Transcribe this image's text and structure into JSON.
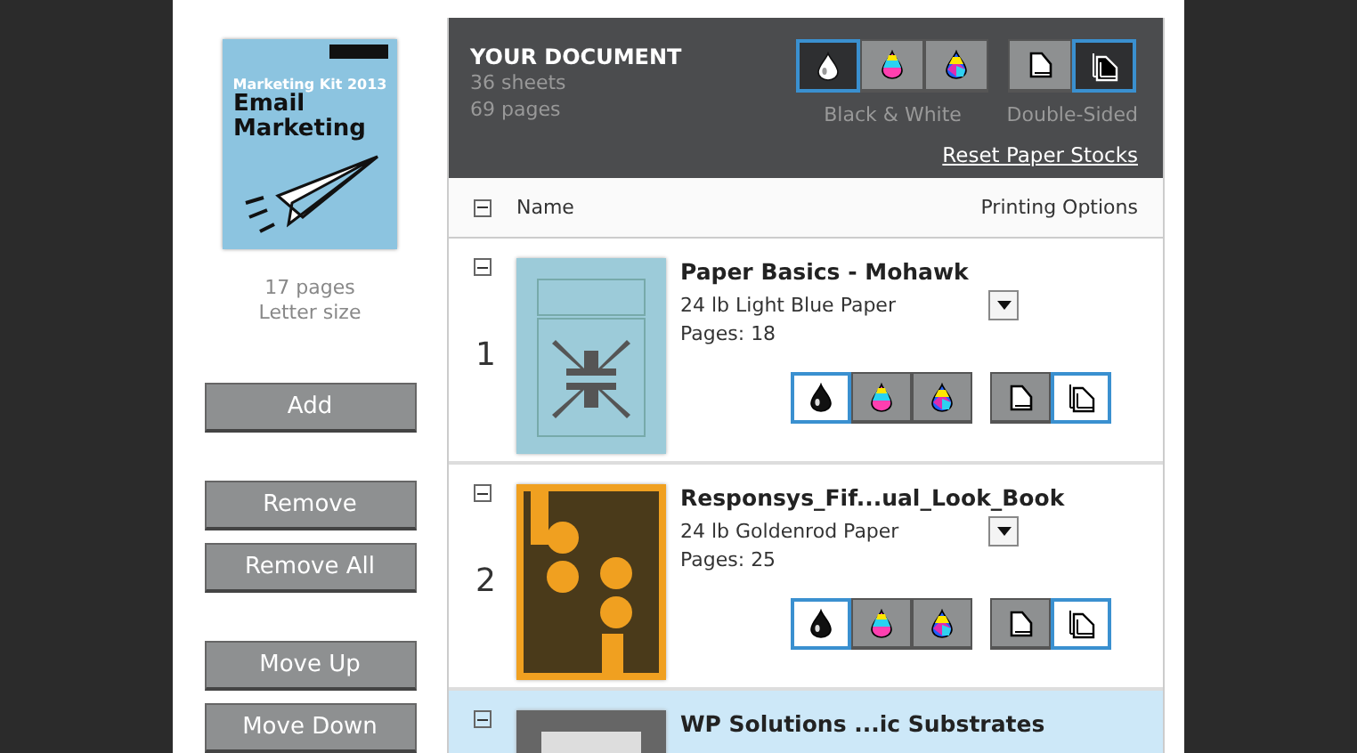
{
  "document": {
    "cover": {
      "kit": "Marketing Kit 2013",
      "title": "Email Marketing"
    },
    "page_count": "17 pages",
    "size": "Letter size"
  },
  "button_groups": [
    [
      "Add"
    ],
    [
      "Remove",
      "Remove All"
    ],
    [
      "Move Up",
      "Move Down"
    ]
  ],
  "summary": {
    "title": "YOUR DOCUMENT",
    "sheets": "36 sheets",
    "pages": "69 pages",
    "color_options": [
      {
        "kind": "bw",
        "selected": true
      },
      {
        "kind": "cmy",
        "selected": false
      },
      {
        "kind": "cmyk",
        "selected": false
      }
    ],
    "color_label": "Black & White",
    "side_options": [
      {
        "kind": "single",
        "selected": false
      },
      {
        "kind": "double",
        "selected": true
      }
    ],
    "side_label": "Double-Sided",
    "reset_link": "Reset Paper Stocks"
  },
  "columns": [
    "Name",
    "Printing Options"
  ],
  "rows": [
    {
      "number": "1",
      "title": "Paper Basics - Mohawk",
      "paper": "24 lb Light Blue Paper",
      "pages": "Pages: 18",
      "kind": "arrows",
      "selected": false,
      "color_options": [
        {
          "kind": "bw",
          "selected": true
        },
        {
          "kind": "cmy",
          "selected": false
        },
        {
          "kind": "cmyk",
          "selected": false
        }
      ],
      "side_options": [
        {
          "kind": "single",
          "selected": false
        },
        {
          "kind": "double",
          "selected": true
        }
      ]
    },
    {
      "number": "2",
      "title": "Responsys_Fif...ual_Look_Book",
      "paper": "24 lb Goldenrod Paper",
      "pages": "Pages: 25",
      "kind": "book",
      "selected": false,
      "color_options": [
        {
          "kind": "bw",
          "selected": true
        },
        {
          "kind": "cmy",
          "selected": false
        },
        {
          "kind": "cmyk",
          "selected": false
        }
      ],
      "side_options": [
        {
          "kind": "single",
          "selected": false
        },
        {
          "kind": "double",
          "selected": true
        }
      ]
    },
    {
      "title": "WP Solutions ...ic Substrates",
      "kind": "grey",
      "selected": true
    }
  ]
}
